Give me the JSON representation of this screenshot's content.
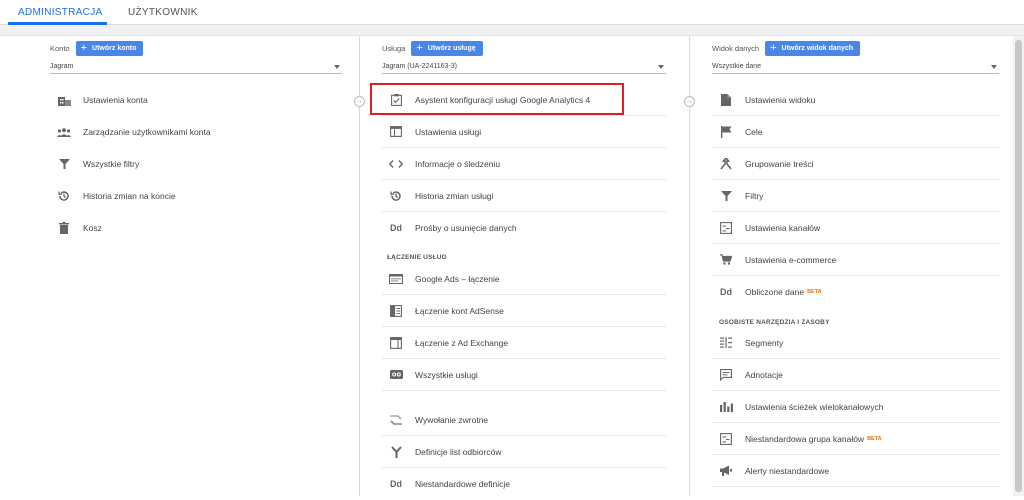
{
  "tabs": {
    "admin": "ADMINISTRACJA",
    "user": "UŻYTKOWNIK"
  },
  "konto": {
    "label": "Konto",
    "create_button": "Utwórz konto",
    "selected": "Jagram",
    "items": [
      {
        "label": "Ustawienia konta",
        "icon": "building-icon"
      },
      {
        "label": "Zarządzanie użytkownikami konta",
        "icon": "users-icon"
      },
      {
        "label": "Wszystkie filtry",
        "icon": "filter-icon"
      },
      {
        "label": "Historia zmian na koncie",
        "icon": "history-icon"
      },
      {
        "label": "Kosz",
        "icon": "trash-icon"
      }
    ]
  },
  "usluga": {
    "label": "Usługa",
    "create_button": "Utwórz usługę",
    "selected": "Jagram (UA-2241163-3)",
    "items": [
      {
        "label": "Asystent konfiguracji usługi Google Analytics 4",
        "icon": "checklist-icon"
      },
      {
        "label": "Ustawienia usługi",
        "icon": "window-icon"
      },
      {
        "label": "Informacje o śledzeniu",
        "icon": "code-icon"
      },
      {
        "label": "Historia zmian usługi",
        "icon": "history-icon"
      },
      {
        "label": "Prośby o usunięcie danych",
        "icon": "dd-icon"
      }
    ],
    "section_title": "ŁĄCZENIE USŁUG",
    "link_items": [
      {
        "label": "Google Ads – łączenie",
        "icon": "ads-icon"
      },
      {
        "label": "Łączenie kont AdSense",
        "icon": "adsense-icon"
      },
      {
        "label": "Łączenie z Ad Exchange",
        "icon": "adexchange-icon"
      },
      {
        "label": "Wszystkie usługi",
        "icon": "services-icon"
      }
    ],
    "more_items": [
      {
        "label": "Wywołanie zwrotne",
        "icon": "postback-icon"
      },
      {
        "label": "Definicje list odbiorców",
        "icon": "audience-icon"
      },
      {
        "label": "Niestandardowe definicje",
        "icon": "dd-icon"
      }
    ],
    "dd_glyph": "Dd"
  },
  "widok": {
    "label": "Widok danych",
    "create_button": "Utwórz widok danych",
    "selected": "Wszystkie dane",
    "items": [
      {
        "label": "Ustawienia widoku",
        "icon": "document-icon"
      },
      {
        "label": "Cele",
        "icon": "flag-icon"
      },
      {
        "label": "Grupowanie treści",
        "icon": "grouping-icon"
      },
      {
        "label": "Filtry",
        "icon": "filter-icon"
      },
      {
        "label": "Ustawienia kanałów",
        "icon": "channels-icon"
      },
      {
        "label": "Ustawienia e-commerce",
        "icon": "cart-icon"
      },
      {
        "label": "Obliczone dane",
        "icon": "dd-icon",
        "badge": "BETA"
      }
    ],
    "section_title": "OSOBISTE NARZĘDZIA I ZASOBY",
    "tool_items": [
      {
        "label": "Segmenty",
        "icon": "segments-icon"
      },
      {
        "label": "Adnotacje",
        "icon": "annotation-icon"
      },
      {
        "label": "Ustawienia ścieżek wielokanałowych",
        "icon": "bars-icon"
      },
      {
        "label": "Niestandardowa grupa kanałów",
        "icon": "channels-icon",
        "badge": "BETA"
      },
      {
        "label": "Alerty niestandardowe",
        "icon": "megaphone-icon"
      }
    ]
  },
  "colors": {
    "accent": "#1a73e8",
    "button": "#4a86e8",
    "highlight": "#e01b24",
    "beta": "#e8710a"
  }
}
